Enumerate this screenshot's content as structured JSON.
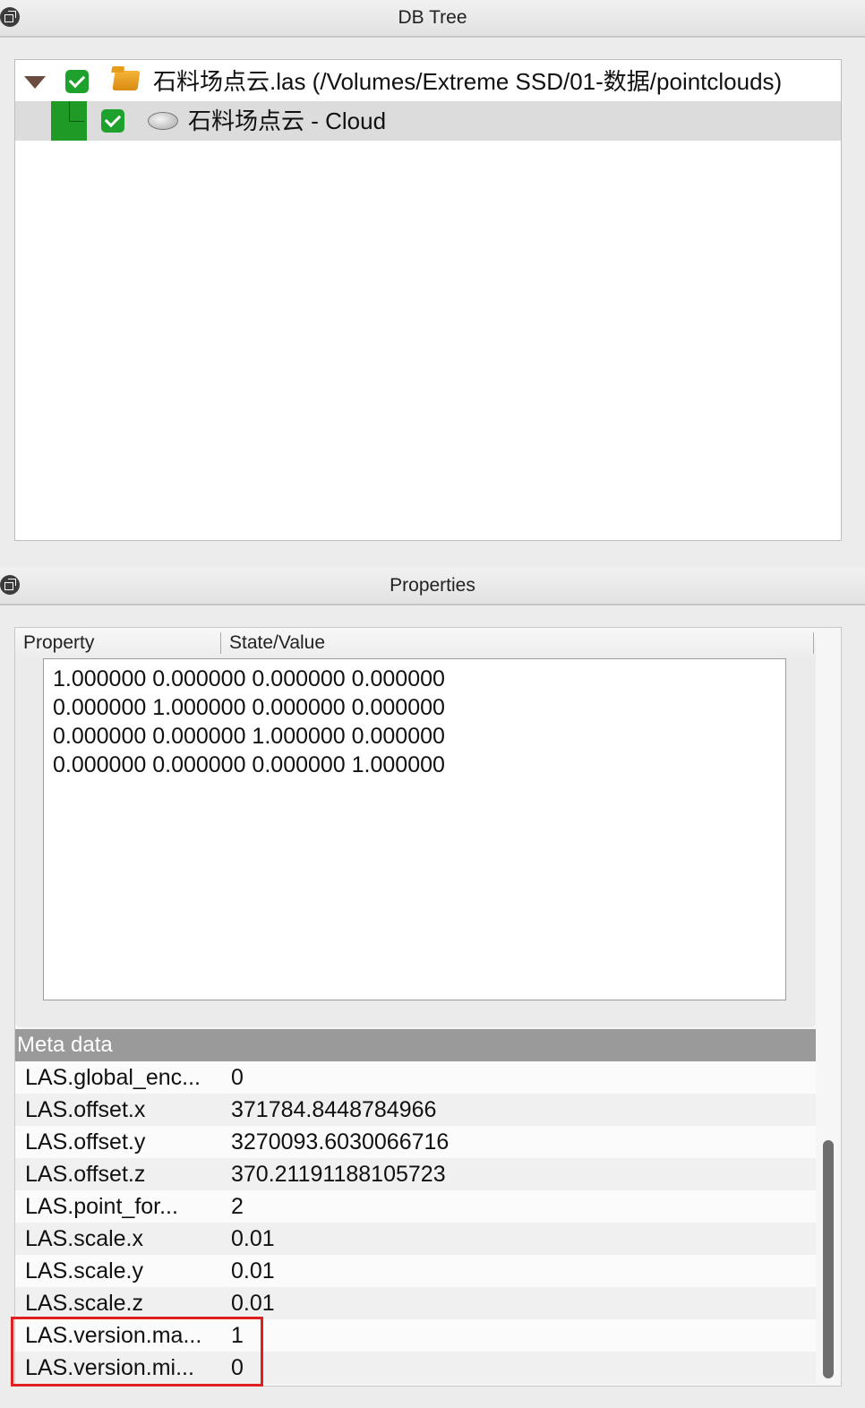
{
  "db_tree": {
    "title": "DB Tree",
    "items": [
      {
        "label": "石料场点云.las (/Volumes/Extreme SSD/01-数据/pointclouds)",
        "checked": true,
        "icon": "folder-icon"
      },
      {
        "label": "石料场点云 - Cloud",
        "checked": true,
        "icon": "cloud-icon",
        "selected": true
      }
    ]
  },
  "properties": {
    "title": "Properties",
    "columns": [
      "Property",
      "State/Value"
    ],
    "matrix_lines": [
      "1.000000 0.000000 0.000000 0.000000",
      "0.000000 1.000000 0.000000 0.000000",
      "0.000000 0.000000 1.000000 0.000000",
      "0.000000 0.000000 0.000000 1.000000"
    ],
    "meta_header": "Meta data",
    "meta_rows": [
      {
        "key": "LAS.global_enc...",
        "value": "0"
      },
      {
        "key": "LAS.offset.x",
        "value": "371784.8448784966"
      },
      {
        "key": "LAS.offset.y",
        "value": "3270093.6030066716"
      },
      {
        "key": "LAS.offset.z",
        "value": "370.21191188105723"
      },
      {
        "key": "LAS.point_for...",
        "value": "2"
      },
      {
        "key": "LAS.scale.x",
        "value": "0.01"
      },
      {
        "key": "LAS.scale.y",
        "value": "0.01"
      },
      {
        "key": "LAS.scale.z",
        "value": "0.01"
      },
      {
        "key": "LAS.version.ma...",
        "value": "1"
      },
      {
        "key": "LAS.version.mi...",
        "value": "0"
      }
    ]
  },
  "colors": {
    "check": "#1fa12d",
    "highlight": "#e02020",
    "meta_header_bg": "#9a9a9a"
  }
}
